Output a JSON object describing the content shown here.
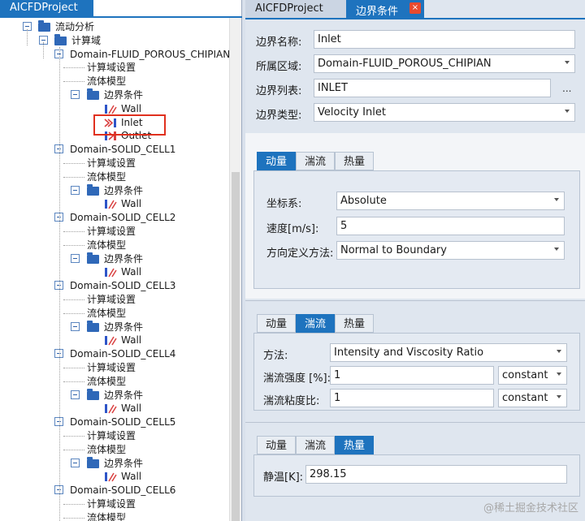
{
  "left_panel": {
    "tab_label": "AICFDProject",
    "tree": {
      "root": "流动分析",
      "group": "计算域",
      "domains": [
        {
          "name": "Domain-FLUID_POROUS_CHIPIAN",
          "settings": "计算域设置",
          "model": "流体模型",
          "bc": "边界条件",
          "items": [
            "Wall",
            "Inlet",
            "Outlet"
          ]
        },
        {
          "name": "Domain-SOLID_CELL1",
          "settings": "计算域设置",
          "model": "流体模型",
          "bc": "边界条件",
          "items": [
            "Wall"
          ]
        },
        {
          "name": "Domain-SOLID_CELL2",
          "settings": "计算域设置",
          "model": "流体模型",
          "bc": "边界条件",
          "items": [
            "Wall"
          ]
        },
        {
          "name": "Domain-SOLID_CELL3",
          "settings": "计算域设置",
          "model": "流体模型",
          "bc": "边界条件",
          "items": [
            "Wall"
          ]
        },
        {
          "name": "Domain-SOLID_CELL4",
          "settings": "计算域设置",
          "model": "流体模型",
          "bc": "边界条件",
          "items": [
            "Wall"
          ]
        },
        {
          "name": "Domain-SOLID_CELL5",
          "settings": "计算域设置",
          "model": "流体模型",
          "bc": "边界条件",
          "items": [
            "Wall"
          ]
        },
        {
          "name": "Domain-SOLID_CELL6",
          "settings": "计算域设置",
          "model": "流体模型",
          "bc": "",
          "items": []
        }
      ]
    }
  },
  "right_panel": {
    "tabs": [
      "AICFDProject",
      "边界条件"
    ],
    "close_icon": "×",
    "boundary_name_label": "边界名称:",
    "boundary_name_value": "Inlet",
    "region_label": "所属区域:",
    "region_value": "Domain-FLUID_POROUS_CHIPIAN",
    "list_label": "边界列表:",
    "list_value": "INLET",
    "list_browse": "...",
    "type_label": "边界类型:",
    "type_value": "Velocity Inlet",
    "section_tabs": [
      "动量",
      "湍流",
      "热量"
    ],
    "momentum": {
      "coord_label": "坐标系:",
      "coord_value": "Absolute",
      "speed_label": "速度[m/s]:",
      "speed_value": "5",
      "dir_label": "方向定义方法:",
      "dir_value": "Normal to Boundary"
    },
    "turbulence": {
      "method_label": "方法:",
      "method_value": "Intensity and Viscosity Ratio",
      "intensity_label": "湍流强度 [%]:",
      "intensity_value": "1",
      "intensity_mode": "constant",
      "viscosity_label": "湍流粘度比:",
      "viscosity_value": "1",
      "viscosity_mode": "constant"
    },
    "heat": {
      "temp_label": "静温[K]:",
      "temp_value": "298.15"
    }
  },
  "watermark": "@稀土掘金技术社区",
  "colors": {
    "accent": "#1e73be",
    "highlight": "#e0301e"
  }
}
